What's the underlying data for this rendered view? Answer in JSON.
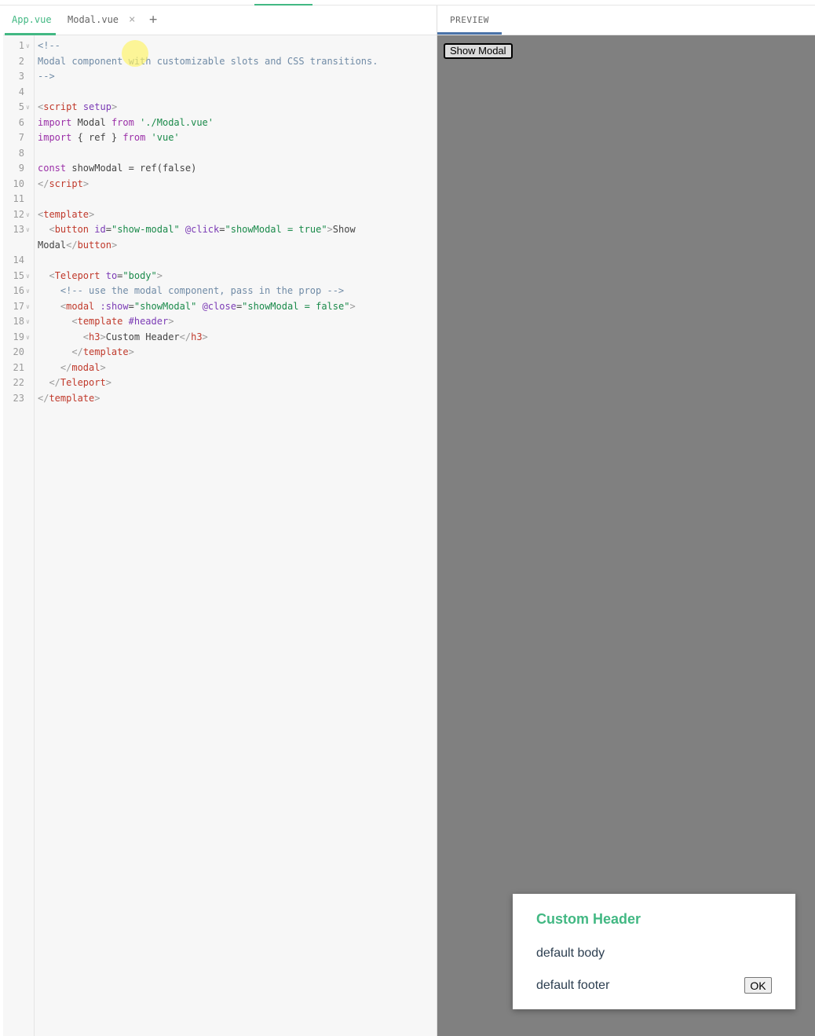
{
  "editor": {
    "tabs": [
      {
        "label": "App.vue",
        "active": true
      },
      {
        "label": "Modal.vue",
        "active": false
      }
    ],
    "close_glyph": "×",
    "add_glyph": "+",
    "lines": [
      {
        "n": "1",
        "fold": true,
        "tokens": [
          [
            "<!--",
            "comment"
          ]
        ]
      },
      {
        "n": "2",
        "fold": false,
        "tokens": [
          [
            "Modal component with customizable slots and CSS transitions.",
            "comment"
          ]
        ]
      },
      {
        "n": "3",
        "fold": false,
        "tokens": [
          [
            "-->",
            "comment"
          ]
        ]
      },
      {
        "n": "4",
        "fold": false,
        "tokens": []
      },
      {
        "n": "5",
        "fold": true,
        "tokens": [
          [
            "<",
            "br"
          ],
          [
            "script",
            "tag"
          ],
          [
            " ",
            "plain"
          ],
          [
            "setup",
            "attr"
          ],
          [
            ">",
            "br"
          ]
        ]
      },
      {
        "n": "6",
        "fold": false,
        "tokens": [
          [
            "import",
            "kw"
          ],
          [
            " Modal ",
            "plain"
          ],
          [
            "from",
            "kw"
          ],
          [
            " ",
            "plain"
          ],
          [
            "'./Modal.vue'",
            "str"
          ]
        ]
      },
      {
        "n": "7",
        "fold": false,
        "tokens": [
          [
            "import",
            "kw"
          ],
          [
            " { ref } ",
            "plain"
          ],
          [
            "from",
            "kw"
          ],
          [
            " ",
            "plain"
          ],
          [
            "'vue'",
            "str"
          ]
        ]
      },
      {
        "n": "8",
        "fold": false,
        "tokens": []
      },
      {
        "n": "9",
        "fold": false,
        "tokens": [
          [
            "const",
            "kw"
          ],
          [
            " showModal = ref(false)",
            "plain"
          ]
        ]
      },
      {
        "n": "10",
        "fold": false,
        "tokens": [
          [
            "</",
            "br"
          ],
          [
            "script",
            "tag"
          ],
          [
            ">",
            "br"
          ]
        ]
      },
      {
        "n": "11",
        "fold": false,
        "tokens": []
      },
      {
        "n": "12",
        "fold": true,
        "tokens": [
          [
            "<",
            "br"
          ],
          [
            "template",
            "tag"
          ],
          [
            ">",
            "br"
          ]
        ]
      },
      {
        "n": "13",
        "fold": true,
        "tall": true,
        "tokens": [
          [
            "  <",
            "br"
          ],
          [
            "button",
            "tag"
          ],
          [
            " ",
            "plain"
          ],
          [
            "id",
            "attr"
          ],
          [
            "=",
            "plain"
          ],
          [
            "\"show-modal\"",
            "str"
          ],
          [
            " ",
            "plain"
          ],
          [
            "@click",
            "attr"
          ],
          [
            "=",
            "plain"
          ],
          [
            "\"showModal = true\"",
            "str"
          ],
          [
            ">",
            "br"
          ],
          [
            "Show Modal",
            "plain"
          ],
          [
            "</",
            "br"
          ],
          [
            "button",
            "tag"
          ],
          [
            ">",
            "br"
          ]
        ]
      },
      {
        "n": "14",
        "fold": false,
        "tokens": []
      },
      {
        "n": "15",
        "fold": true,
        "tokens": [
          [
            "  <",
            "br"
          ],
          [
            "Teleport",
            "tag"
          ],
          [
            " ",
            "plain"
          ],
          [
            "to",
            "attr"
          ],
          [
            "=",
            "plain"
          ],
          [
            "\"body\"",
            "str"
          ],
          [
            ">",
            "br"
          ]
        ]
      },
      {
        "n": "16",
        "fold": true,
        "tokens": [
          [
            "    <!-- use the modal component, pass in the prop -->",
            "comment"
          ]
        ]
      },
      {
        "n": "17",
        "fold": true,
        "tokens": [
          [
            "    <",
            "br"
          ],
          [
            "modal",
            "tag"
          ],
          [
            " ",
            "plain"
          ],
          [
            ":show",
            "attr"
          ],
          [
            "=",
            "plain"
          ],
          [
            "\"showModal\"",
            "str"
          ],
          [
            " ",
            "plain"
          ],
          [
            "@close",
            "attr"
          ],
          [
            "=",
            "plain"
          ],
          [
            "\"showModal = false\"",
            "str"
          ],
          [
            ">",
            "br"
          ]
        ]
      },
      {
        "n": "18",
        "fold": true,
        "tokens": [
          [
            "      <",
            "br"
          ],
          [
            "template",
            "tag"
          ],
          [
            " ",
            "plain"
          ],
          [
            "#header",
            "attr"
          ],
          [
            ">",
            "br"
          ]
        ]
      },
      {
        "n": "19",
        "fold": true,
        "tokens": [
          [
            "        <",
            "br"
          ],
          [
            "h3",
            "tag"
          ],
          [
            ">",
            "br"
          ],
          [
            "Custom Header",
            "plain"
          ],
          [
            "</",
            "br"
          ],
          [
            "h3",
            "tag"
          ],
          [
            ">",
            "br"
          ]
        ]
      },
      {
        "n": "20",
        "fold": false,
        "tokens": [
          [
            "      </",
            "br"
          ],
          [
            "template",
            "tag"
          ],
          [
            ">",
            "br"
          ]
        ]
      },
      {
        "n": "21",
        "fold": false,
        "tokens": [
          [
            "    </",
            "br"
          ],
          [
            "modal",
            "tag"
          ],
          [
            ">",
            "br"
          ]
        ]
      },
      {
        "n": "22",
        "fold": false,
        "tokens": [
          [
            "  </",
            "br"
          ],
          [
            "Teleport",
            "tag"
          ],
          [
            ">",
            "br"
          ]
        ]
      },
      {
        "n": "23",
        "fold": false,
        "tokens": [
          [
            "</",
            "br"
          ],
          [
            "template",
            "tag"
          ],
          [
            ">",
            "br"
          ]
        ]
      }
    ]
  },
  "preview": {
    "tab_label": "PREVIEW",
    "show_modal_label": "Show Modal",
    "modal": {
      "header": "Custom Header",
      "body": "default body",
      "footer": "default footer",
      "ok_label": "OK"
    }
  },
  "colors": {
    "accent": "#42b883",
    "preview_backdrop": "#808080",
    "preview_tab_underline": "#4a73a8"
  },
  "icons": [
    "close-icon",
    "plus-icon",
    "fold-arrow-icon"
  ]
}
